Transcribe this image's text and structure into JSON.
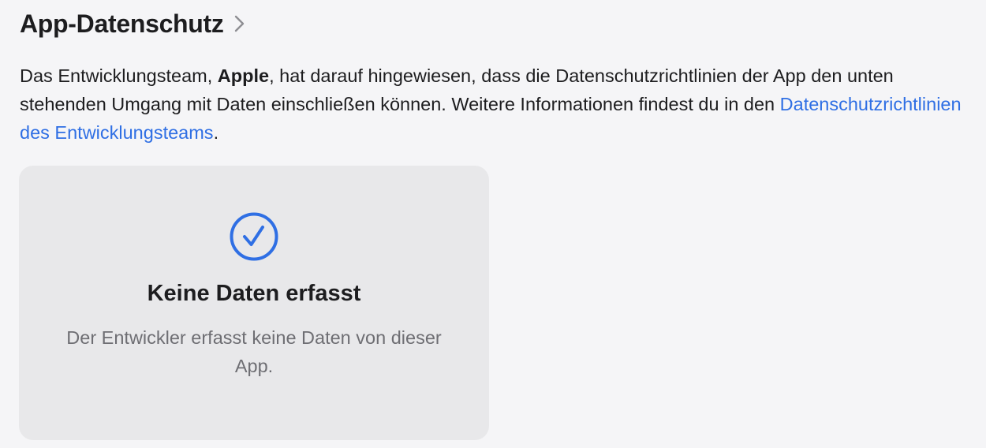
{
  "header": {
    "title": "App-Datenschutz",
    "chevron_icon": "chevron-right-icon"
  },
  "description": {
    "part1": "Das Entwicklungsteam, ",
    "developer": "Apple",
    "part2": ", hat darauf hingewiesen, dass die Datenschutzrichtlinien der App den unten stehenden Umgang mit Daten einschließen können. Weitere Informationen findest du in den ",
    "link": "Datenschutzrichtlinien des Entwicklungsteams",
    "part3": "."
  },
  "card": {
    "icon": "checkmark-circle-icon",
    "title": "Keine Daten erfasst",
    "text": "Der Entwickler erfasst keine Daten von dieser App."
  },
  "colors": {
    "accent": "#2f6fe4",
    "background": "#f5f5f7",
    "card_background": "#e8e8ea",
    "secondary_text": "#6e6e73"
  }
}
